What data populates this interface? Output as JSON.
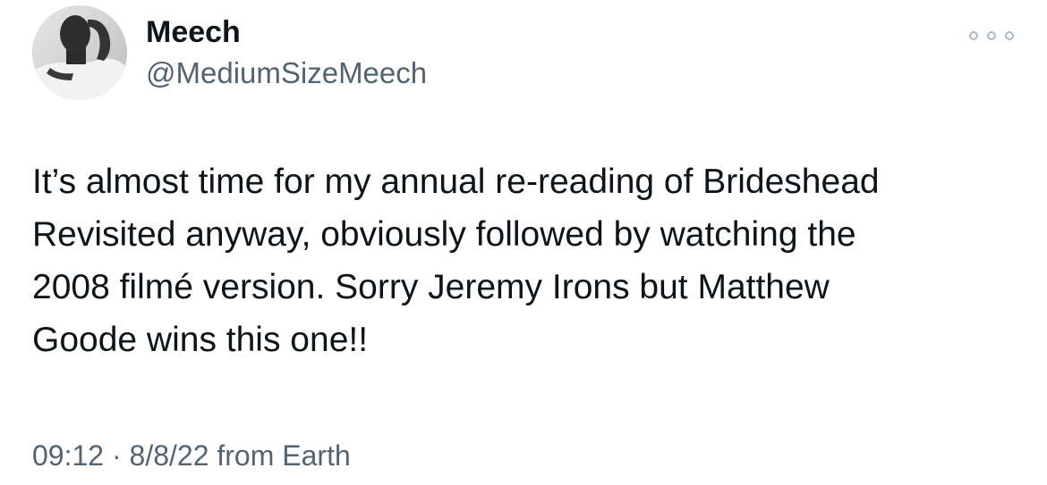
{
  "tweet": {
    "author": {
      "display_name": "Meech",
      "handle": "@MediumSizeMeech"
    },
    "more_icon": "more-horizontal-icon",
    "text_lines": [
      "It’s almost time for my annual re-reading of Brideshead",
      "Revisited anyway, obviously followed by watching the",
      "2008 filmé version. Sorry Jeremy Irons but Matthew",
      "Goode wins this one!!"
    ],
    "time": "09:12",
    "separator": " · ",
    "date": "8/8/22",
    "source": " from Earth"
  },
  "colors": {
    "text": "#0f1419",
    "secondary": "#536471",
    "more_dots": "#aab8c2"
  }
}
